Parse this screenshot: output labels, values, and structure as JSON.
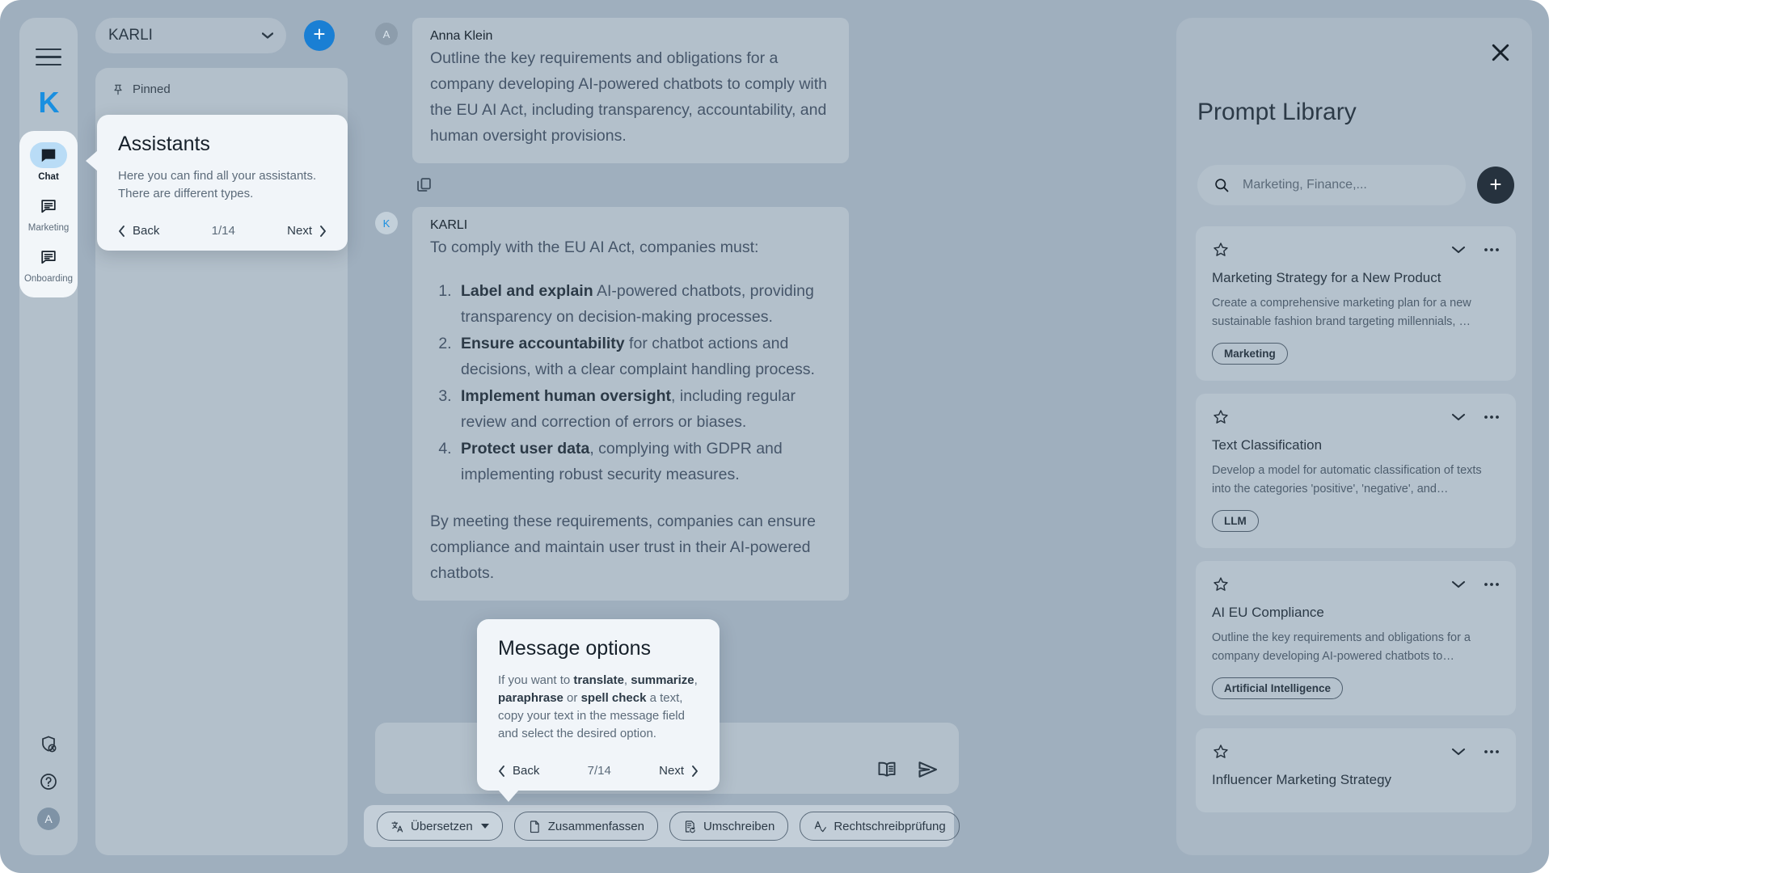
{
  "rail": {
    "brand": "K",
    "items": [
      {
        "label": "Chat",
        "icon": "chat-filled-icon",
        "active": true
      },
      {
        "label": "Marketing",
        "icon": "chat-lines-icon",
        "active": false
      },
      {
        "label": "Onboarding",
        "icon": "chat-lines-icon",
        "active": false
      }
    ],
    "bottom": [
      {
        "icon": "shield-user-icon"
      },
      {
        "icon": "help-circle-icon"
      }
    ],
    "avatar_initial": "A"
  },
  "conversations": {
    "assistant_selected": "KARLI",
    "new_chat_label": "+",
    "pinned_label": "Pinned",
    "pinned_items": [
      ""
    ]
  },
  "chat": {
    "messages": [
      {
        "author": "Anna Klein",
        "avatar_initial": "A",
        "role": "user",
        "text": "Outline the key requirements and obligations for a company developing AI-powered chatbots to comply with the EU AI Act, including transparency, accountability, and human oversight provisions."
      },
      {
        "author": "KARLI",
        "avatar_initial": "K",
        "role": "assistant",
        "intro": "To comply with the EU AI Act, companies must:",
        "list": [
          {
            "bold": "Label and explain",
            "rest": " AI-powered chatbots, providing transparency on decision-making processes."
          },
          {
            "bold": "Ensure accountability",
            "rest": " for chatbot actions and decisions, with a clear complaint handling process."
          },
          {
            "bold": "Implement human oversight",
            "rest": ", including regular review and correction of errors or biases."
          },
          {
            "bold": "Protect user data",
            "rest": ", complying with GDPR and implementing robust security measures."
          }
        ],
        "outro": "By meeting these requirements, companies can ensure compliance and maintain user trust in their AI-powered chatbots."
      }
    ],
    "copy_action_icon": "copy-icon"
  },
  "composer": {
    "book_icon": "book-icon",
    "send_icon": "send-icon",
    "tools": [
      {
        "label": "Übersetzen",
        "icon": "translate-icon",
        "has_caret": true,
        "primary": true
      },
      {
        "label": "Zusammenfassen",
        "icon": "document-icon",
        "has_caret": false,
        "primary": false
      },
      {
        "label": "Umschreiben",
        "icon": "rewrite-icon",
        "has_caret": false,
        "primary": false
      },
      {
        "label": "Rechtschreibprüfung",
        "icon": "spellcheck-icon",
        "has_caret": false,
        "primary": false
      }
    ]
  },
  "prompt_library": {
    "title": "Prompt Library",
    "close_icon": "close-icon",
    "search_placeholder": "Marketing, Finance,...",
    "search_value": "",
    "add_label": "+",
    "cards": [
      {
        "title": "Marketing Strategy for a New Product",
        "description": "Create a comprehensive marketing plan for a new sustainable fashion brand targeting millennials, …",
        "tag": "Marketing"
      },
      {
        "title": "Text Classification",
        "description": "Develop a model for automatic classification of texts into the categories 'positive', 'negative', and…",
        "tag": "LLM"
      },
      {
        "title": "AI EU Compliance",
        "description": "Outline the key requirements and obligations for a company developing AI-powered chatbots to…",
        "tag": "Artificial Intelligence"
      },
      {
        "title": "Influencer Marketing Strategy",
        "description": "",
        "tag": ""
      }
    ]
  },
  "coachmarks": [
    {
      "id": "assistants",
      "title": "Assistants",
      "body_plain": "Here you can find all your assistants. There are different types.",
      "back_label": "Back",
      "counter": "1/14",
      "next_label": "Next"
    },
    {
      "id": "message-options",
      "title": "Message options",
      "body_prefix": "If you want to ",
      "b1": "translate",
      "sep1": ", ",
      "b2": "summarize",
      "sep2": ", ",
      "b3": "paraphrase",
      "sep3": " or ",
      "b4": "spell check",
      "body_suffix": " a text, copy your text in the message field and select the desired option.",
      "back_label": "Back",
      "counter": "7/14",
      "next_label": "Next"
    }
  ],
  "colors": {
    "app_bg": "#9fafbe",
    "panel": "#b3c0cb",
    "accent_blue": "#1a7fd4",
    "brand_blue": "#1a8fe0",
    "tooltip_bg": "#f1f5f9",
    "dark_text": "#2c3a47"
  }
}
